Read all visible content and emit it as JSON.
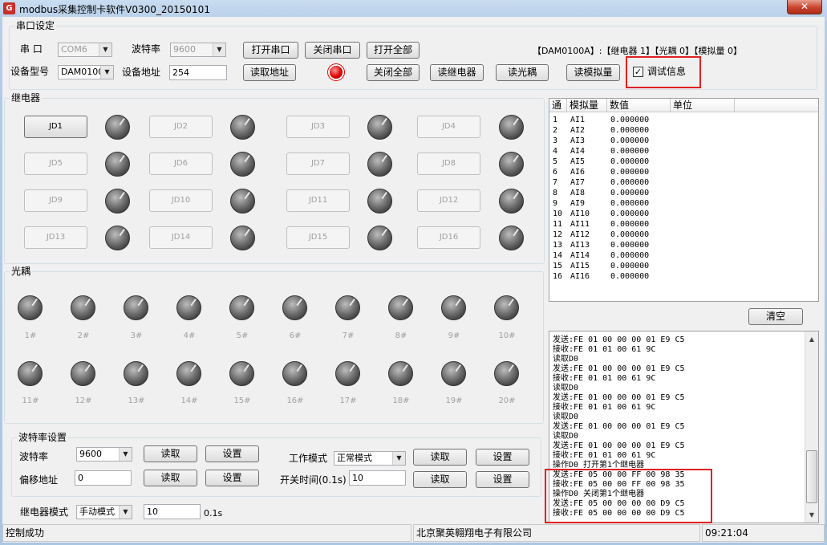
{
  "window": {
    "title": "modbus采集控制卡软件V0300_20150101",
    "close": "✕",
    "icon_letter": "G"
  },
  "serial": {
    "group_title": "串口设定",
    "port_label": "串  口",
    "port_value": "COM6",
    "baud_label": "波特率",
    "baud_value": "9600",
    "open_port": "打开串口",
    "close_port": "关闭串口",
    "open_all": "打开全部",
    "model_label": "设备型号",
    "model_value": "DAM0100A",
    "addr_label": "设备地址",
    "addr_value": "254",
    "read_addr": "读取地址",
    "close_all": "关闭全部",
    "read_relay": "读继电器",
    "read_optic": "读光耦",
    "read_analog": "读模拟量",
    "debug_label": "调试信息",
    "debug_checked": "✓",
    "summary": "【DAM0100A】:【继电器  1】【光耦 0】【模拟量 0】"
  },
  "relay": {
    "group_title": "继电器",
    "buttons": [
      "JD1",
      "JD2",
      "JD3",
      "JD4",
      "JD5",
      "JD6",
      "JD7",
      "JD8",
      "JD9",
      "JD10",
      "JD11",
      "JD12",
      "JD13",
      "JD14",
      "JD15",
      "JD16"
    ]
  },
  "optic": {
    "group_title": "光耦",
    "labels": [
      "1#",
      "2#",
      "3#",
      "4#",
      "5#",
      "6#",
      "7#",
      "8#",
      "9#",
      "10#",
      "11#",
      "12#",
      "13#",
      "14#",
      "15#",
      "16#",
      "17#",
      "18#",
      "19#",
      "20#"
    ]
  },
  "baudset": {
    "group_title": "波特率设置",
    "baud_label": "波特率",
    "baud_value": "9600",
    "offset_label": "偏移地址",
    "offset_value": "0",
    "read": "读取",
    "set": "设置",
    "mode_label": "工作模式",
    "mode_value": "正常模式",
    "time_label": "开关时间(0.1s)",
    "time_value": "10"
  },
  "relaymode": {
    "label": "继电器模式",
    "mode_value": "手动模式",
    "time_value": "10",
    "unit": "0.1s"
  },
  "analog_table": {
    "headers": [
      "通",
      "模拟量",
      "数值",
      "单位"
    ],
    "rows": [
      [
        "1",
        "AI1",
        "0.000000"
      ],
      [
        "2",
        "AI2",
        "0.000000"
      ],
      [
        "3",
        "AI3",
        "0.000000"
      ],
      [
        "4",
        "AI4",
        "0.000000"
      ],
      [
        "5",
        "AI5",
        "0.000000"
      ],
      [
        "6",
        "AI6",
        "0.000000"
      ],
      [
        "7",
        "AI7",
        "0.000000"
      ],
      [
        "8",
        "AI8",
        "0.000000"
      ],
      [
        "9",
        "AI9",
        "0.000000"
      ],
      [
        "10",
        "AI10",
        "0.000000"
      ],
      [
        "11",
        "AI11",
        "0.000000"
      ],
      [
        "12",
        "AI12",
        "0.000000"
      ],
      [
        "13",
        "AI13",
        "0.000000"
      ],
      [
        "14",
        "AI14",
        "0.000000"
      ],
      [
        "15",
        "AI15",
        "0.000000"
      ],
      [
        "16",
        "AI16",
        "0.000000"
      ]
    ]
  },
  "clear_label": "清空",
  "log_lines": [
    "发送:FE 01 00 00 00 01 E9 C5",
    "接收:FE 01 01 00 61 9C",
    "读取D0",
    "发送:FE 01 00 00 00 01 E9 C5",
    "接收:FE 01 01 00 61 9C",
    "读取D0",
    "发送:FE 01 00 00 00 01 E9 C5",
    "接收:FE 01 01 00 61 9C",
    "读取D0",
    "发送:FE 01 00 00 00 01 E9 C5",
    "读取D0",
    "发送:FE 01 00 00 00 01 E9 C5",
    "接收:FE 01 01 00 61 9C",
    "操作D0  打开第1个继电器",
    "发送:FE 05 00 00 FF 00 98 35",
    "接收:FE 05 00 00 FF 00 98 35",
    "操作D0  关闭第1个继电器",
    "发送:FE 05 00 00 00 00 D9 C5",
    "接收:FE 05 00 00 00 00 D9 C5"
  ],
  "statusbar": {
    "left": "控制成功",
    "middle": "北京聚英翱翔电子有限公司",
    "time": "09:21:04"
  }
}
